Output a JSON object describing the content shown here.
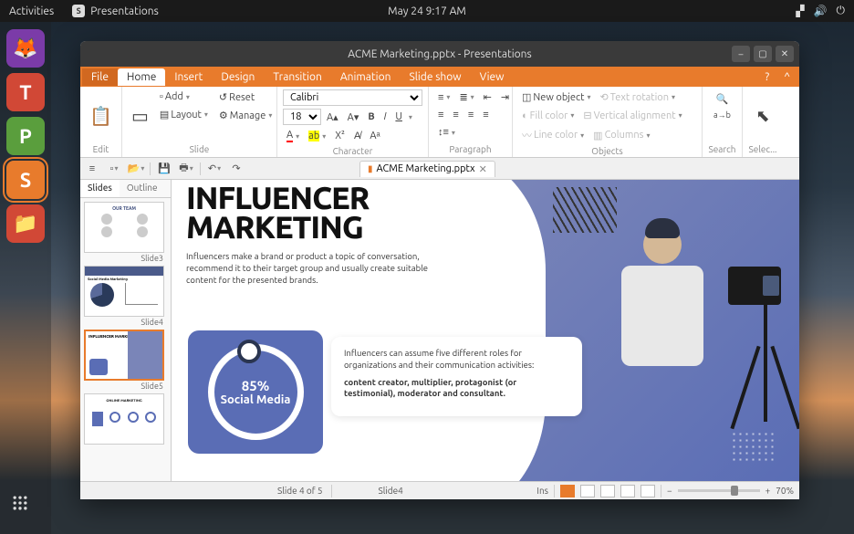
{
  "topbar": {
    "activities": "Activities",
    "app": "Presentations",
    "datetime": "May 24  9:17 AM"
  },
  "window": {
    "title": "ACME Marketing.pptx - Presentations"
  },
  "menus": [
    "File",
    "Home",
    "Insert",
    "Design",
    "Transition",
    "Animation",
    "Slide show",
    "View"
  ],
  "ribbon": {
    "edit": {
      "label": "Edit"
    },
    "slide": {
      "label": "Slide",
      "add": "Add",
      "reset": "Reset",
      "layout": "Layout",
      "manage": "Manage"
    },
    "character": {
      "label": "Character",
      "font": "Calibri",
      "size": "18"
    },
    "paragraph": {
      "label": "Paragraph"
    },
    "objects": {
      "label": "Objects",
      "newobj": "New object",
      "textrot": "Text rotation",
      "fill": "Fill color",
      "valign": "Vertical alignment",
      "line": "Line color",
      "cols": "Columns"
    },
    "search": {
      "label": "Search"
    },
    "select": {
      "label": "Selec..."
    }
  },
  "doctab": "ACME Marketing.pptx",
  "panel": {
    "slides": "Slides",
    "outline": "Outline"
  },
  "thumbs": [
    {
      "label": "Slide3",
      "title": "OUR TEAM"
    },
    {
      "label": "Slide4",
      "title": "Social Media Marketing"
    },
    {
      "label": "Slide5",
      "title": "INFLUENCER MARKETING",
      "selected": true
    },
    {
      "label": "",
      "title": "ONLINE MARKETING"
    }
  ],
  "slide": {
    "title_l1": "INFLUENCER",
    "title_l2": "MARKETING",
    "body": "Influencers make a brand or product a topic of conversation, recommend it to their target group and usually create suitable content for the presented brands.",
    "pct": "85%",
    "pct_label": "Social Media",
    "card_p1": "Influencers can assume five different roles for organizations and their communication activities:",
    "card_p2": "content creator, multiplier, protagonist (or testimonial), moderator and consultant."
  },
  "status": {
    "pos": "Slide 4 of 5",
    "name": "Slide4",
    "mode": "Ins",
    "zoom": "70%"
  }
}
